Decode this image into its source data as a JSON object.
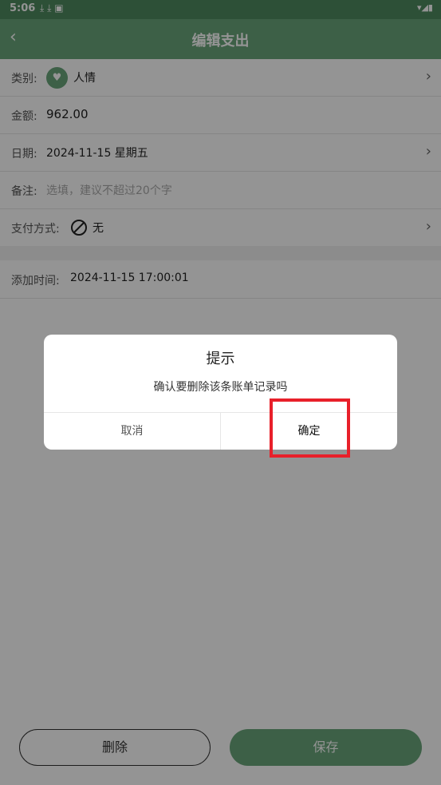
{
  "status_bar": {
    "time": "5:06",
    "notification_icons": "⤓ ⤓ ▣"
  },
  "app_bar": {
    "title": "编辑支出"
  },
  "form": {
    "category": {
      "label": "类别:",
      "value": "人情"
    },
    "amount": {
      "label": "金额:",
      "value": "962.00"
    },
    "date": {
      "label": "日期:",
      "value": "2024-11-15 星期五"
    },
    "note": {
      "label": "备注:",
      "placeholder": "选填，建议不超过20个字"
    },
    "payment": {
      "label": "支付方式:",
      "value": "无"
    },
    "added_time": {
      "label": "添加时间:",
      "value": "2024-11-15 17:00:01"
    }
  },
  "buttons": {
    "delete_label": "删除",
    "save_label": "保存"
  },
  "dialog": {
    "title": "提示",
    "message": "确认要删除该条账单记录吗",
    "cancel_label": "取消",
    "confirm_label": "确定"
  },
  "colors": {
    "accent": "#6aa57a",
    "highlight": "#e8202a"
  }
}
